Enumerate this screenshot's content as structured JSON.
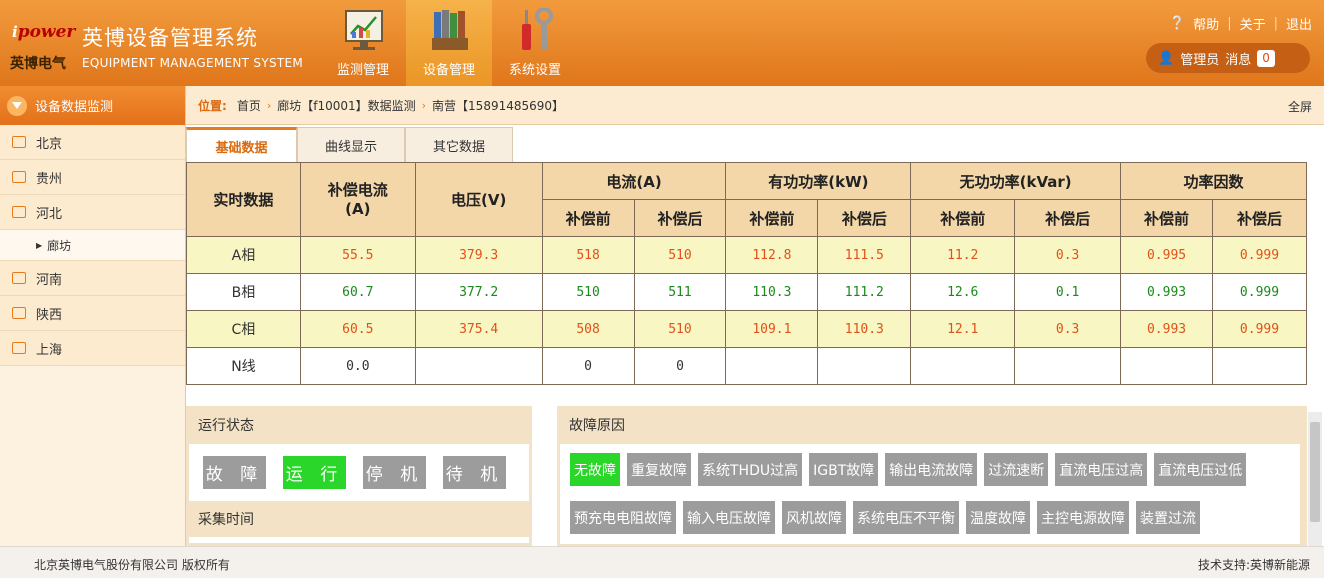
{
  "header": {
    "brand": "power",
    "brand_i": "i",
    "cn_title": "英博设备管理系统",
    "company": "英博电气",
    "en_title": "EQUIPMENT MANAGEMENT SYSTEM",
    "nav": [
      {
        "label": "监测管理",
        "icon": "monitor-chart-icon"
      },
      {
        "label": "设备管理",
        "icon": "folders-icon"
      },
      {
        "label": "系统设置",
        "icon": "tools-icon"
      }
    ],
    "help": "帮助",
    "about": "关于",
    "logout": "退出",
    "user": "管理员",
    "msg": "消息",
    "msg_count": "0"
  },
  "sidebar": {
    "title": "设备数据监测",
    "items": [
      "北京",
      "贵州",
      "河北",
      "河南",
      "陕西",
      "上海"
    ],
    "sub": "廊坊"
  },
  "crumb": {
    "label": "位置:",
    "parts": [
      "首页",
      "廊坊【f10001】数据监测",
      "南营【15891485690】"
    ],
    "fullscreen": "全屏"
  },
  "tabs": [
    "基础数据",
    "曲线显示",
    "其它数据"
  ],
  "table": {
    "h_realtime": "实时数据",
    "h_comp_current": "补偿电流\n(A)",
    "h_voltage": "电压(V)",
    "h_current": "电流(A)",
    "h_active": "有功功率(kW)",
    "h_reactive": "无功功率(kVar)",
    "h_pf": "功率因数",
    "before": "补偿前",
    "after": "补偿后",
    "rows": [
      {
        "name": "A相",
        "cc": "55.5",
        "v": "379.3",
        "i1": "518",
        "i2": "510",
        "p1": "112.8",
        "p2": "111.5",
        "q1": "11.2",
        "q2": "0.3",
        "f1": "0.995",
        "f2": "0.999"
      },
      {
        "name": "B相",
        "cc": "60.7",
        "v": "377.2",
        "i1": "510",
        "i2": "511",
        "p1": "110.3",
        "p2": "111.2",
        "q1": "12.6",
        "q2": "0.1",
        "f1": "0.993",
        "f2": "0.999"
      },
      {
        "name": "C相",
        "cc": "60.5",
        "v": "375.4",
        "i1": "508",
        "i2": "510",
        "p1": "109.1",
        "p2": "110.3",
        "q1": "12.1",
        "q2": "0.3",
        "f1": "0.993",
        "f2": "0.999"
      },
      {
        "name": "N线",
        "cc": "0.0",
        "v": "",
        "i1": "0",
        "i2": "0",
        "p1": "",
        "p2": "",
        "q1": "",
        "q2": "",
        "f1": "",
        "f2": ""
      }
    ]
  },
  "status": {
    "title": "运行状态",
    "buttons": [
      "故 障",
      "运 行",
      "停 机",
      "待 机"
    ],
    "active": "运 行",
    "time_title": "采集时间"
  },
  "faults": {
    "title": "故障原因",
    "items": [
      "无故障",
      "重复故障",
      "系统THDU过高",
      "IGBT故障",
      "输出电流故障",
      "过流速断",
      "直流电压过高",
      "直流电压过低",
      "预充电电阻故障",
      "输入电压故障",
      "风机故障",
      "系统电压不平衡",
      "温度故障",
      "主控电源故障",
      "装置过流"
    ],
    "active": "无故障"
  },
  "footer": {
    "copyright": "北京英博电气股份有限公司 版权所有",
    "support": "技术支持:英博新能源"
  },
  "colors": {
    "accent": "#e57c20",
    "on": "#2ad62a",
    "off": "#9c9c9c",
    "red_value": "#e0521a",
    "green_value": "#1a8a1a"
  }
}
